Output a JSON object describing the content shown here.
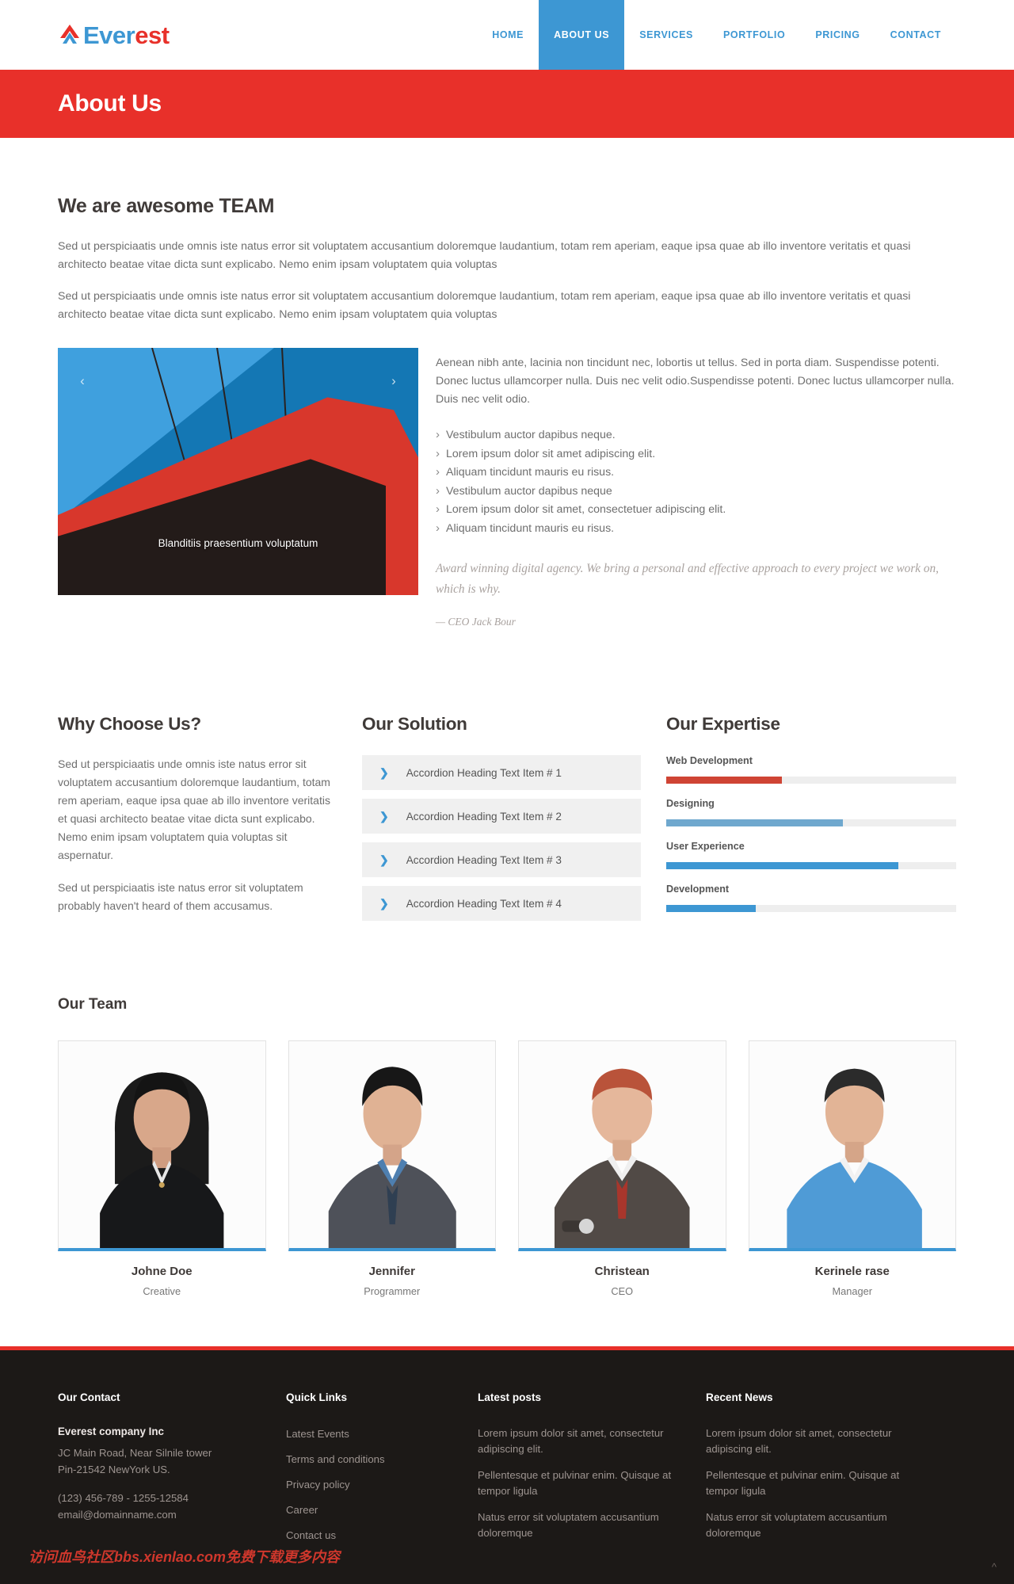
{
  "brand": {
    "part1": "Ever",
    "part2": "est",
    "logo_icon": "mountain-peak-icon"
  },
  "nav": {
    "items": [
      {
        "label": "HOME",
        "active": false
      },
      {
        "label": "ABOUT US",
        "active": true
      },
      {
        "label": "SERVICES",
        "active": false
      },
      {
        "label": "PORTFOLIO",
        "active": false
      },
      {
        "label": "PRICING",
        "active": false
      },
      {
        "label": "CONTACT",
        "active": false
      }
    ]
  },
  "banner": {
    "title": "About Us"
  },
  "about": {
    "heading": "We are awesome TEAM",
    "paragraph1": "Sed ut perspiciaatis unde omnis iste natus error sit voluptatem accusantium doloremque laudantium, totam rem aperiam, eaque ipsa quae ab illo inventore veritatis et quasi architecto beatae vitae dicta sunt explicabo. Nemo enim ipsam voluptatem quia voluptas",
    "paragraph2": "Sed ut perspiciaatis unde omnis iste natus error sit voluptatem accusantium doloremque laudantium, totam rem aperiam, eaque ipsa quae ab illo inventore veritatis et quasi architecto beatae vitae dicta sunt explicabo. Nemo enim ipsam voluptatem quia voluptas"
  },
  "carousel": {
    "caption": "Blanditiis praesentium voluptatum",
    "prev_icon": "chevron-left-icon",
    "next_icon": "chevron-right-icon"
  },
  "media": {
    "intro": "Aenean nibh ante, lacinia non tincidunt nec, lobortis ut tellus. Sed in porta diam. Suspendisse potenti. Donec luctus ullamcorper nulla. Duis nec velit odio.Suspendisse potenti. Donec luctus ullamcorper nulla. Duis nec velit odio.",
    "list": [
      "Vestibulum auctor dapibus neque.",
      "Lorem ipsum dolor sit amet adipiscing elit.",
      "Aliquam tincidunt mauris eu risus.",
      "Vestibulum auctor dapibus neque",
      "Lorem ipsum dolor sit amet, consectetuer adipiscing elit.",
      "Aliquam tincidunt mauris eu risus."
    ],
    "quote": "Award winning digital agency. We bring a personal and effective approach to every project we work on, which is why.",
    "quote_author": "— CEO Jack Bour"
  },
  "why": {
    "title": "Why Choose Us?",
    "paragraph1": "Sed ut perspiciaatis unde omnis iste natus error sit voluptatem accusantium doloremque laudantium, totam rem aperiam, eaque ipsa quae ab illo inventore veritatis et quasi architecto beatae vitae dicta sunt explicabo. Nemo enim ipsam voluptatem quia voluptas sit aspernatur.",
    "paragraph2": "Sed ut perspiciaatis iste natus error sit voluptatem probably haven't heard of them accusamus."
  },
  "solution": {
    "title": "Our Solution",
    "items": [
      {
        "label": "Accordion Heading Text Item # 1",
        "icon": "chevron-right-icon"
      },
      {
        "label": "Accordion Heading Text Item # 2",
        "icon": "chevron-right-icon"
      },
      {
        "label": "Accordion Heading Text Item # 3",
        "icon": "chevron-right-icon"
      },
      {
        "label": "Accordion Heading Text Item # 4",
        "icon": "chevron-right-icon"
      }
    ]
  },
  "expertise": {
    "title": "Our Expertise",
    "skills": [
      {
        "label": "Web Development",
        "percent": 40,
        "color": "#cf4434"
      },
      {
        "label": "Designing",
        "percent": 61,
        "color": "#6fa8ce"
      },
      {
        "label": "User Experience",
        "percent": 80,
        "color": "#3d97d3"
      },
      {
        "label": "Development",
        "percent": 31,
        "color": "#3d97d3"
      }
    ]
  },
  "team": {
    "title": "Our Team",
    "members": [
      {
        "name": "Johne Doe",
        "role": "Creative"
      },
      {
        "name": "Jennifer",
        "role": "Programmer"
      },
      {
        "name": "Christean",
        "role": "CEO"
      },
      {
        "name": "Kerinele rase",
        "role": "Manager"
      }
    ]
  },
  "footer": {
    "contact": {
      "title": "Our Contact",
      "company": "Everest company Inc",
      "address_line1": "JC Main Road, Near Silnile tower",
      "address_line2": "Pin-21542 NewYork US.",
      "phone": "(123) 456-789 - 1255-12584",
      "email": "email@domainname.com"
    },
    "quick_links": {
      "title": "Quick Links",
      "items": [
        "Latest Events",
        "Terms and conditions",
        "Privacy policy",
        "Career",
        "Contact us"
      ]
    },
    "latest_posts": {
      "title": "Latest posts",
      "items": [
        "Lorem ipsum dolor sit amet, consectetur adipiscing elit.",
        "Pellentesque et pulvinar enim. Quisque at tempor ligula",
        "Natus error sit voluptatem accusantium doloremque"
      ]
    },
    "recent_news": {
      "title": "Recent News",
      "items": [
        "Lorem ipsum dolor sit amet, consectetur adipiscing elit.",
        "Pellentesque et pulvinar enim. Quisque at tempor ligula",
        "Natus error sit voluptatem accusantium doloremque"
      ]
    },
    "watermark": "访问血鸟社区bbs.xienlao.com免费下载更多内容",
    "scroll_top_icon": "chevron-up-icon"
  },
  "colors": {
    "brand_red": "#e8302a",
    "brand_blue": "#3d97d3",
    "footer_bg": "#1c1917"
  }
}
